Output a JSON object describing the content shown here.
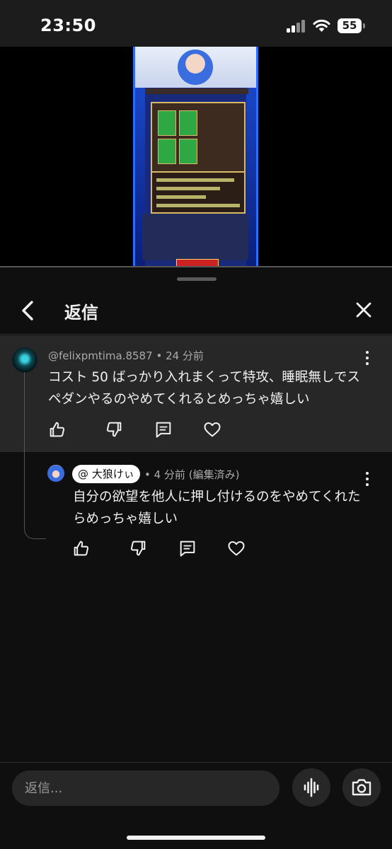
{
  "status_bar": {
    "time": "23:50",
    "battery_level": "55",
    "icons": [
      "cellular-signal-icon",
      "wifi-icon",
      "battery-icon"
    ]
  },
  "video": {
    "description_icon": "game-video-thumbnail"
  },
  "sheet": {
    "title": "返信",
    "back_icon": "chevron-left-icon",
    "close_icon": "close-icon"
  },
  "parent_comment": {
    "author": "@felixpmtima.8587",
    "time": "24 分前",
    "text": "コスト 50 ばっかり入れまくって特攻、睡眠無しでスペダンやるのやめてくれるとめっちゃ嬉しい"
  },
  "reply_comment": {
    "author": "@ 大狼けぃ",
    "time": "4 分前",
    "edited": "(編集済み)",
    "text": "自分の欲望を他人に押し付けるのをやめてくれたらめっちゃ嬉しい"
  },
  "actions": [
    "like-icon",
    "dislike-icon",
    "reply-icon",
    "heart-icon"
  ],
  "composer": {
    "placeholder": "返信...",
    "mic_icon": "voice-icon",
    "camera_icon": "camera-icon"
  },
  "colors": {
    "background": "#0f0f0f",
    "highlight": "#272727",
    "secondary_text": "#aaaaaa",
    "primary_text": "#f1f1f1"
  }
}
